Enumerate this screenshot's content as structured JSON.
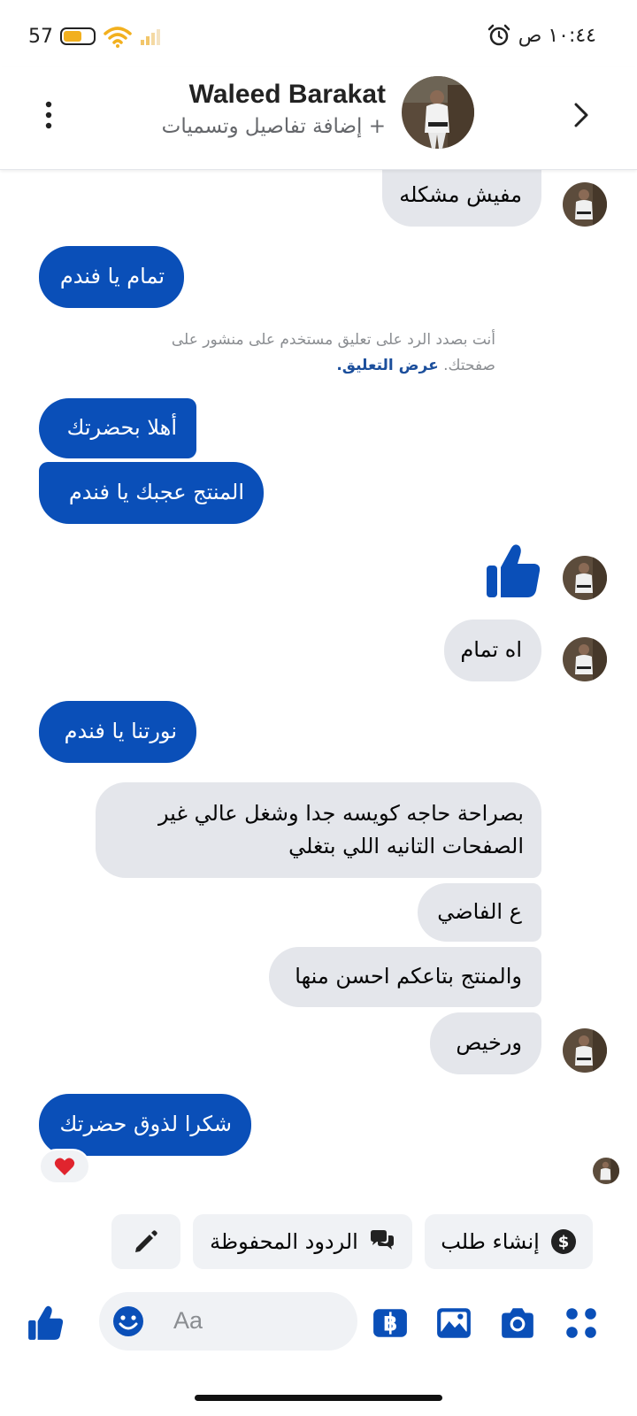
{
  "status_bar": {
    "battery": "57",
    "time": "١٠:٤٤ ص",
    "icons": [
      "battery-icon",
      "wifi-icon",
      "signal-icon",
      "alarm-icon"
    ]
  },
  "header": {
    "name": "Waleed Barakat",
    "subtitle": "+ إضافة تفاصيل وتسميات",
    "icons": [
      "back-icon",
      "more-icon"
    ]
  },
  "messages": [
    {
      "side": "in",
      "text": "مفيش مشكله"
    },
    {
      "side": "out",
      "text": "تمام يا فندم"
    },
    {
      "side": "out",
      "text": "أهلا بحضرتك"
    },
    {
      "side": "out",
      "text": "المنتج عجبك يا فندم"
    },
    {
      "side": "in",
      "type": "like"
    },
    {
      "side": "in",
      "text": "اه تمام"
    },
    {
      "side": "out",
      "text": "نورتنا يا فندم"
    },
    {
      "side": "in",
      "lines": [
        "بصراحة حاجه كويسه جدا وشغل عالي غير",
        "الصفحات التانيه اللي بتغلي"
      ]
    },
    {
      "side": "in",
      "text": "ع الفاضي"
    },
    {
      "side": "in",
      "text": "والمنتج بتاعكم احسن منها"
    },
    {
      "side": "in",
      "text": "ورخيص"
    },
    {
      "side": "out",
      "text": "شكرا لذوق حضرتك"
    }
  ],
  "notice": {
    "text": "أنت بصدد الرد على تعليق مستخدم على منشور على صفحتك.",
    "link": "عرض التعليق."
  },
  "reaction": "heart",
  "quick_replies": {
    "create_order": "إنشاء طلب",
    "saved_replies": "الردود المحفوظة",
    "icons": [
      "dollar-icon",
      "chat-bubbles-icon",
      "pencil-icon"
    ]
  },
  "composer": {
    "placeholder": "Aa",
    "icons": [
      "apps-icon",
      "camera-icon",
      "gallery-icon",
      "pay-icon",
      "emoji-icon",
      "like-icon"
    ]
  },
  "colors": {
    "accent": "#0a4fb8",
    "bubble_in": "#e4e6eb",
    "heart": "#e0242e"
  }
}
